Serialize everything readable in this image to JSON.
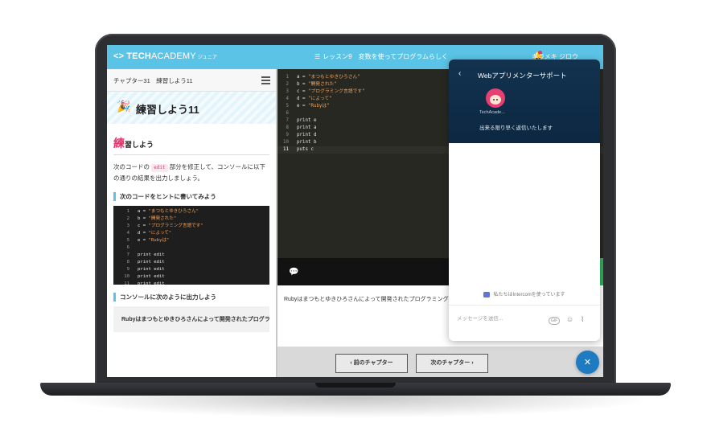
{
  "header": {
    "logo_mark": "<>",
    "logo_bold": "TECH",
    "logo_light": "ACADEMY",
    "logo_sub": "ジュニア",
    "list_icon": "☰",
    "lesson": "レッスン9",
    "lesson_title": "変数を使ってプログラムらしく",
    "user_name": "キラメキ ジロウ",
    "bell_icon": "notification-bell-icon"
  },
  "left_panel": {
    "chapter_label": "チャプター31　練習しよう11",
    "banner_title": "練習しよう11",
    "section_first_char": "練",
    "section_rest": "習しよう",
    "instruction_before": "次のコードの",
    "instruction_code": "edit",
    "instruction_after": "部分を修正して、コンソールに以下の通りの結果を出力しましょう。",
    "hint_heading": "次のコードをヒントに書いてみよう",
    "hint_code": [
      {
        "ln": "1",
        "pre": "a = ",
        "str": "\"まつもとゆきひろさん\""
      },
      {
        "ln": "2",
        "pre": "b = ",
        "str": "\"開発された\""
      },
      {
        "ln": "3",
        "pre": "c = ",
        "str": "\"プログラミング言語です\""
      },
      {
        "ln": "4",
        "pre": "d = ",
        "str": "\"によって\""
      },
      {
        "ln": "5",
        "pre": "e = ",
        "str": "\"Rubyは\""
      },
      {
        "ln": "6",
        "pre": "",
        "str": ""
      },
      {
        "ln": "7",
        "pre": "print edit",
        "str": ""
      },
      {
        "ln": "8",
        "pre": "print edit",
        "str": ""
      },
      {
        "ln": "9",
        "pre": "print edit",
        "str": ""
      },
      {
        "ln": "10",
        "pre": "print edit",
        "str": ""
      },
      {
        "ln": "11",
        "pre": "print edit",
        "str": ""
      }
    ],
    "console_heading": "コンソールに次のように出力しよう",
    "expected_output": "Rubyはまつもとゆきひろさんによって開発されたプログラミング言語です"
  },
  "editor": {
    "lines": [
      {
        "ln": "1",
        "pre": "a = ",
        "str": "\"まつもとゆきひろさん\""
      },
      {
        "ln": "2",
        "pre": "b = ",
        "str": "\"開発された\""
      },
      {
        "ln": "3",
        "pre": "c = ",
        "str": "\"プログラミング言語です\""
      },
      {
        "ln": "4",
        "pre": "d = ",
        "str": "\"によって\""
      },
      {
        "ln": "5",
        "pre": "e = ",
        "str": "\"Rubyは\""
      },
      {
        "ln": "6",
        "pre": "",
        "str": ""
      },
      {
        "ln": "7",
        "pre": "print e",
        "str": ""
      },
      {
        "ln": "8",
        "pre": "print a",
        "str": ""
      },
      {
        "ln": "9",
        "pre": "print d",
        "str": ""
      },
      {
        "ln": "10",
        "pre": "print b",
        "str": ""
      },
      {
        "ln": "11",
        "pre": "puts c",
        "str": ""
      }
    ],
    "active_line": 11,
    "result_text": "Rubyはまつもとゆきひろさんによって開発されたプログラミング言語です"
  },
  "nav": {
    "prev_label": "前のチャプター",
    "next_label": "次のチャプター",
    "prev_icon": "‹",
    "next_icon": "›"
  },
  "messenger": {
    "back_icon": "‹",
    "title": "Webアプリメンターサポート",
    "agent_name": "TechAcade...",
    "reply_note": "出来る限り早く返信いたします",
    "intercom_note": "私たちはIntercomを使っています",
    "input_placeholder": "メッセージを送信...",
    "gif_label": "GIF",
    "emoji_icon": "☺",
    "attach_icon": "⌇",
    "close_icon": "✕"
  },
  "colors": {
    "header_blue": "#5bc4e6",
    "accent_pink": "#e5336b",
    "messenger_navy": "#0c2741",
    "fab_blue": "#1f7bc1"
  }
}
